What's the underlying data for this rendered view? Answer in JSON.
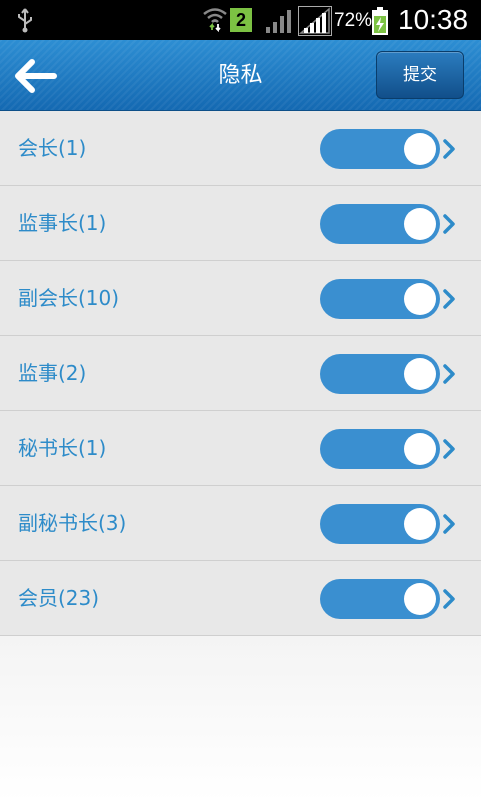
{
  "status_bar": {
    "sim_slot": "2",
    "battery_percent": "72%",
    "time": "10:38",
    "icons": [
      "usb-icon",
      "wifi-icon",
      "signal-icon",
      "battery-charging-icon"
    ]
  },
  "header": {
    "title": "隐私",
    "submit_label": "提交",
    "back_icon": "back-arrow-icon"
  },
  "privacy_list": {
    "items": [
      {
        "label": "会长(1)",
        "enabled": true
      },
      {
        "label": "监事长(1)",
        "enabled": true
      },
      {
        "label": "副会长(10)",
        "enabled": true
      },
      {
        "label": "监事(2)",
        "enabled": true
      },
      {
        "label": "秘书长(1)",
        "enabled": true
      },
      {
        "label": "副秘书长(3)",
        "enabled": true
      },
      {
        "label": "会员(23)",
        "enabled": true
      }
    ]
  },
  "colors": {
    "header_blue": "#1a74bd",
    "toggle_on": "#3a8fd0",
    "label_text": "#2d8bc9",
    "row_bg": "#e8e8e8"
  }
}
